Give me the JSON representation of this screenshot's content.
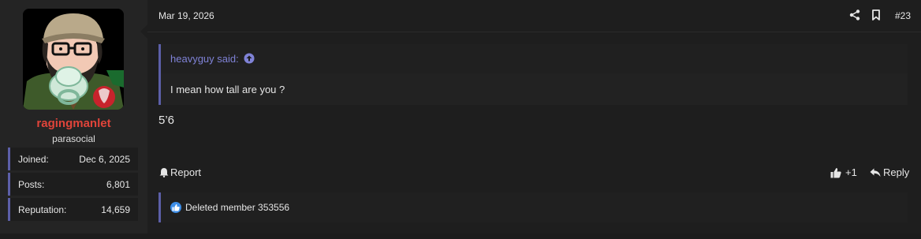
{
  "user": {
    "username": "ragingmanlet",
    "title": "parasocial",
    "stats": [
      {
        "label": "Joined:",
        "value": "Dec 6, 2025"
      },
      {
        "label": "Posts:",
        "value": "6,801"
      },
      {
        "label": "Reputation:",
        "value": "14,659"
      }
    ]
  },
  "post": {
    "date": "Mar 19, 2026",
    "number": "#23",
    "quote": {
      "author": "heavyguy said:",
      "text": "I mean how tall are you ?"
    },
    "message": "5’6",
    "actions": {
      "report": "Report",
      "like_count": "+1",
      "reply": "Reply"
    },
    "reactions": {
      "text": "Deleted member 353556"
    }
  },
  "colors": {
    "username": "#e0443a",
    "accent": "#5c5fa8",
    "quote_author": "#7f82d6",
    "like": "#3d8ee8"
  }
}
